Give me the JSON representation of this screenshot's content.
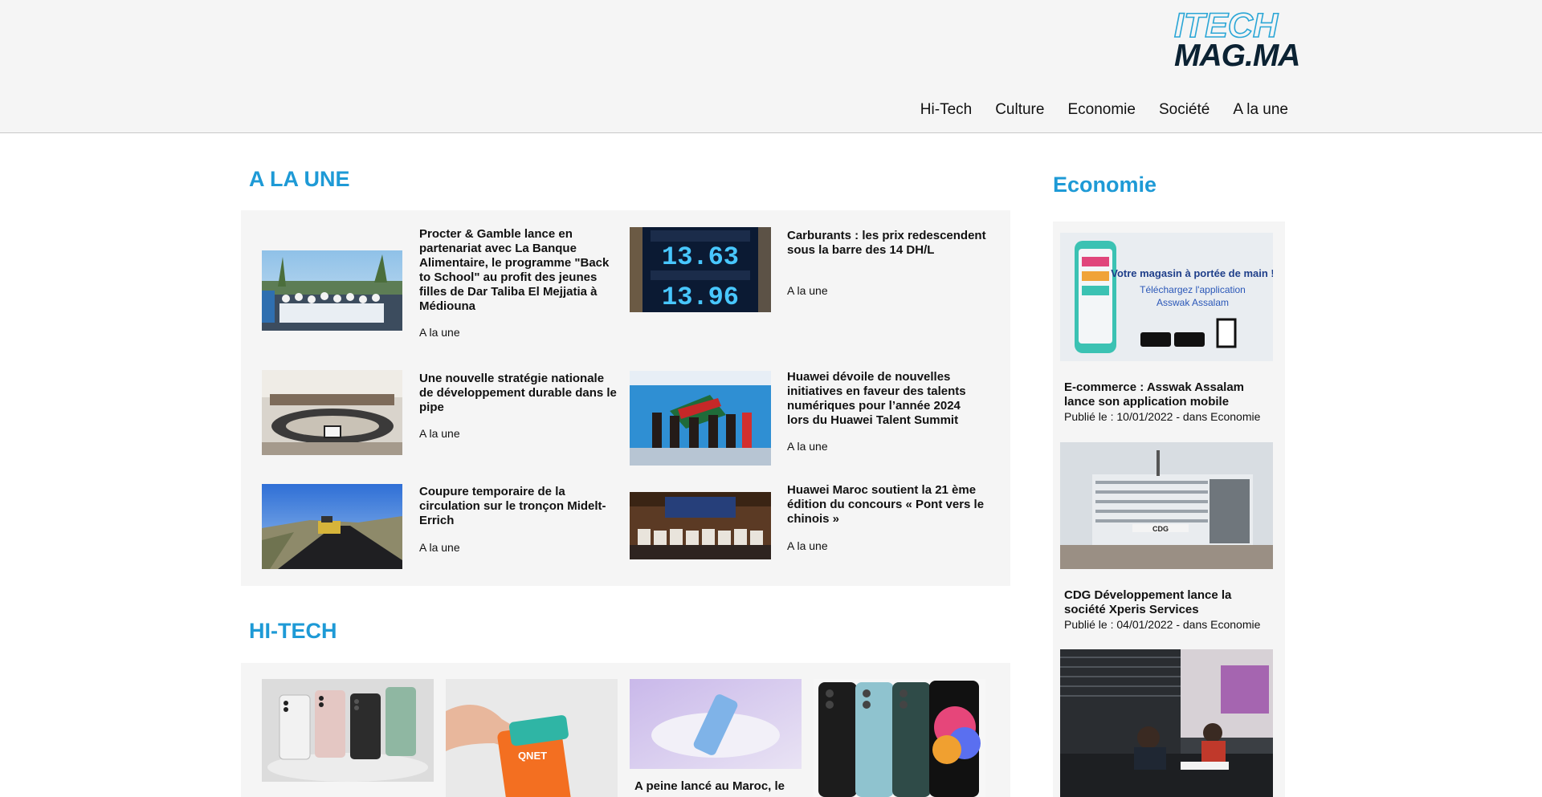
{
  "site": {
    "logo_top": "ITECH",
    "logo_bottom": "MAG.MA"
  },
  "nav": [
    {
      "label": "Hi-Tech"
    },
    {
      "label": "Culture"
    },
    {
      "label": "Economie"
    },
    {
      "label": "Société"
    },
    {
      "label": "A la une"
    }
  ],
  "a_la_une": {
    "title": "A LA UNE",
    "articles": [
      {
        "title": "Procter & Gamble lance en partenariat avec La Banque Alimentaire, le programme \"Back to School\" au profit des jeunes filles de Dar Taliba El Mejjatia à Médiouna",
        "category": "A la une"
      },
      {
        "title": "Carburants : les prix redescendent sous la barre des 14 DH/L",
        "category": "A la une"
      },
      {
        "title": "Une nouvelle stratégie nationale de développement durable dans le pipe",
        "category": "A la une"
      },
      {
        "title": "Huawei dévoile de nouvelles initiatives en faveur des talents numériques pour l’année 2024 lors du Huawei Talent Summit",
        "category": "A la une"
      },
      {
        "title": "Coupure temporaire de la circulation sur le tronçon Midelt-Errich",
        "category": "A la une"
      },
      {
        "title": "Huawei Maroc soutient la 21 ème édition du concours « Pont vers le chinois »",
        "category": "A la une"
      }
    ],
    "fuel_sign": {
      "top_price": "13.63",
      "bottom_price": "13.96"
    }
  },
  "hi_tech": {
    "title": "HI-TECH",
    "articles": [
      {
        "title": ""
      },
      {
        "title": "",
        "brand_text": "QNET"
      },
      {
        "title": "A peine lancé au Maroc, le"
      },
      {
        "title": ""
      }
    ]
  },
  "economie": {
    "title": "Economie",
    "articles": [
      {
        "title": "E-commerce : Asswak Assalam lance son application mobile",
        "meta": "Publié le : 10/01/2022 - dans Economie",
        "ad_line1": "Votre magasin à portée de main !",
        "ad_line2": "Téléchargez l'application",
        "ad_line3": "Asswak Assalam"
      },
      {
        "title": "CDG Développement lance la société Xperis Services",
        "meta": "Publié le : 04/01/2022 - dans Economie",
        "sign": "CDG"
      },
      {
        "title": "",
        "meta": ""
      }
    ]
  },
  "colors": {
    "accent": "#1e9ad6",
    "panel": "#f5f5f5",
    "header_bg": "#f5f5f5"
  }
}
